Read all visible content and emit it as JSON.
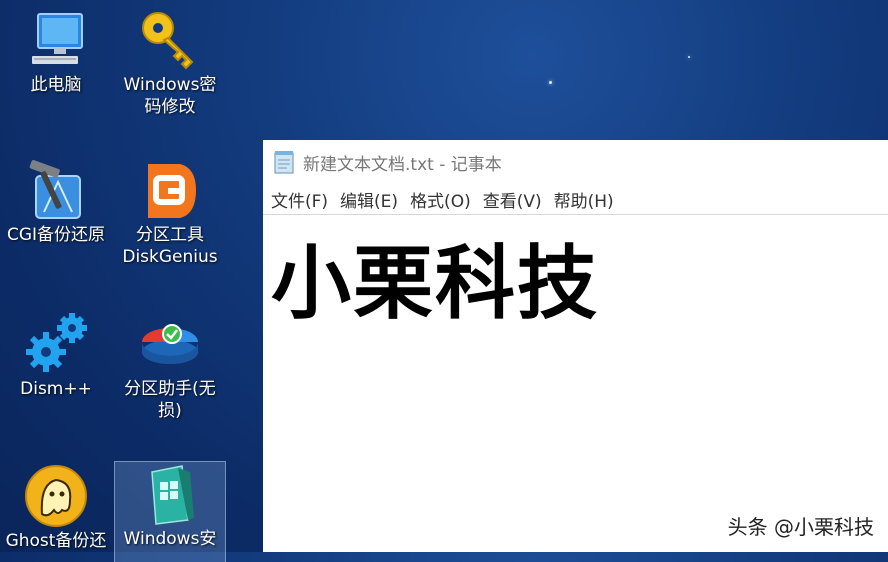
{
  "desktop": {
    "icons": [
      {
        "label": "此电脑",
        "icon": "computer-icon"
      },
      {
        "label": "Windows密\n码修改",
        "icon": "key-icon"
      },
      {
        "label": "CGI备份还原",
        "icon": "cgi-backup-icon"
      },
      {
        "label": "分区工具\nDiskGenius",
        "icon": "diskgenius-icon"
      },
      {
        "label": "Dism++",
        "icon": "gears-icon"
      },
      {
        "label": "分区助手(无\n损)",
        "icon": "partition-assistant-icon"
      },
      {
        "label": "Ghost备份还",
        "icon": "ghost-icon"
      },
      {
        "label": "Windows安",
        "icon": "windows-install-icon"
      }
    ]
  },
  "notepad": {
    "title": "新建文本文档.txt - 记事本",
    "menu": [
      "文件(F)",
      "编辑(E)",
      "格式(O)",
      "查看(V)",
      "帮助(H)"
    ],
    "content": "小栗科技"
  },
  "watermark": "头条 @小栗科技"
}
